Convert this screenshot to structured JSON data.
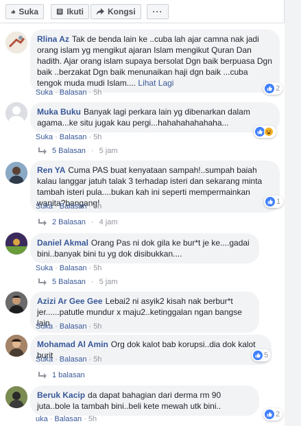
{
  "toolbar": {
    "like_label": "Suka",
    "follow_label": "Ikuti",
    "share_label": "Kongsi",
    "more_label": "···"
  },
  "comments": [
    {
      "name": "Rlina Az",
      "text": "Tak de benda lain ke ..cuba lah ajar camna nak jadi orang islam yg mengikut ajaran Islam mengikut Quran Dan hadith. Ajar orang islam supaya bersolat Dgn baik berpuasa Dgn baik ..berzakat Dgn baik menunaikan haji dgn baik ...cuba tengok muda mudi Islam....",
      "see_more": "Lihat Lagi",
      "like": "Suka",
      "reply": "Balasan",
      "time": "5h",
      "reaction_count": "2",
      "reactions": [
        "like-icon"
      ]
    },
    {
      "name": "Muka Buku",
      "text": "Banyak lagi perkara lain yg dibenarkan dalam agama...ke situ jugak kau pergi...hahahahahahaha...",
      "like": "Suka",
      "reply": "Balasan",
      "time": "5h",
      "reaction_count": "",
      "reactions": [
        "like-icon",
        "haha-icon"
      ],
      "replies_label": "5 Balasan",
      "replies_time": "5 jam"
    },
    {
      "name": "Ren YA",
      "text": "Cuma PAS buat kenyataan sampah!..sumpah baiah kalau langgar jatuh talak 3 terhadap isteri dan sekarang minta tambah isteri pula....bukan kah ini seperti mempermainkan wanita?bangang!",
      "like": "Suka",
      "reply": "Balasan",
      "time": "5h",
      "reaction_count": "1",
      "reactions": [
        "like-icon"
      ],
      "replies_label": "2 Balasan",
      "replies_time": "4 jam"
    },
    {
      "name": "Daniel Akmal",
      "text": "Orang Pas ni dok gila ke bur*t je ke....gadai bini..banyak bini tu yg dok disibukkan....",
      "like": "Suka",
      "reply": "Balasan",
      "time": "5h",
      "replies_label": "5 Balasan",
      "replies_time": "5 jam"
    },
    {
      "name": "Azizi Ar Gee Gee",
      "text": "Lebai2 ni asyik2 kisah nak berbur*t jer......patutle mundur x maju2..ketinggalan ngan bangse lain",
      "like": "Suka",
      "reply": "Balasan",
      "time": "5h"
    },
    {
      "name": "Mohamad Al Amin",
      "text": "Org dok kalot bab korupsi..dia dok kalot burit",
      "like": "Suka",
      "reply": "Balasan",
      "time": "5h",
      "reaction_count": "5",
      "reactions": [
        "like-icon"
      ],
      "replies_label": "1 balasan"
    },
    {
      "name": "Beruk Kacip",
      "text": "da dapat bahagian dari derma rm 90 juta..bole la tambah bini..beli kete mewah utk bini..",
      "like": "uka",
      "reply": "Balasan",
      "time": "5h",
      "reaction_count": "2",
      "reactions": [
        "like-icon"
      ]
    }
  ],
  "colors": {
    "name": "#385898",
    "meta": "#90949c",
    "bubble": "#f2f3f5",
    "like_blue": "#4080ff"
  }
}
